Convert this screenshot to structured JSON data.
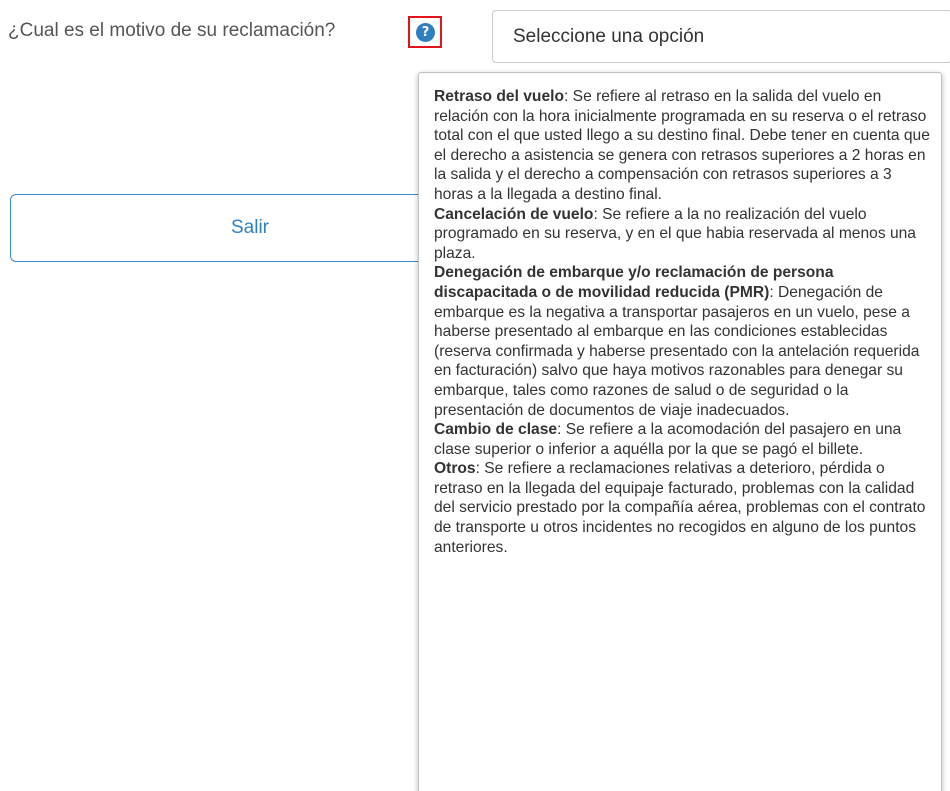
{
  "form": {
    "question": "¿Cual es el motivo de su reclamación?",
    "select_value": "Seleccione una opción",
    "exit_label": "Salir"
  },
  "help": {
    "icon": "question-circle-icon",
    "icon_glyph": "?",
    "highlight_color": "#e2141b",
    "accent_color": "#2f7fc0"
  },
  "tooltip": {
    "items": [
      {
        "term": "Retraso del vuelo",
        "desc": ": Se refiere al retraso en la salida del vuelo en relación con la hora inicialmente programada en su reserva o el retraso total con el que usted llego a su destino final. Debe tener en cuenta que el derecho a asistencia se genera con retrasos superiores a 2 horas en la salida y el derecho a compensación con retrasos superiores a 3 horas a la llegada a destino final."
      },
      {
        "term": "Cancelación de vuelo",
        "desc": ": Se refiere a la no realización del vuelo programado en su reserva, y en el que habia reservada al menos una plaza."
      },
      {
        "term": "Denegación de embarque y/o reclamación de persona discapacitada o de movilidad reducida (PMR)",
        "desc": ": Denegación de embarque es la negativa a transportar pasajeros en un vuelo, pese a haberse presentado al embarque en las condiciones establecidas (reserva confirmada y haberse presentado con la antelación requerida en facturación) salvo que haya motivos razonables para denegar su embarque, tales como razones de salud o de seguridad o la presentación de documentos de viaje inadecuados."
      },
      {
        "term": "Cambio de clase",
        "desc": ": Se refiere a la acomodación del pasajero en una clase superior o inferior a aquélla por la que se pagó el billete."
      },
      {
        "term": "Otros",
        "desc": ": Se refiere a reclamaciones relativas a deterioro, pérdida o retraso en la llegada del equipaje facturado, problemas con la calidad del servicio prestado por la compañía aérea, problemas con el contrato de transporte u otros incidentes no recogidos en alguno de los puntos anteriores."
      }
    ]
  }
}
